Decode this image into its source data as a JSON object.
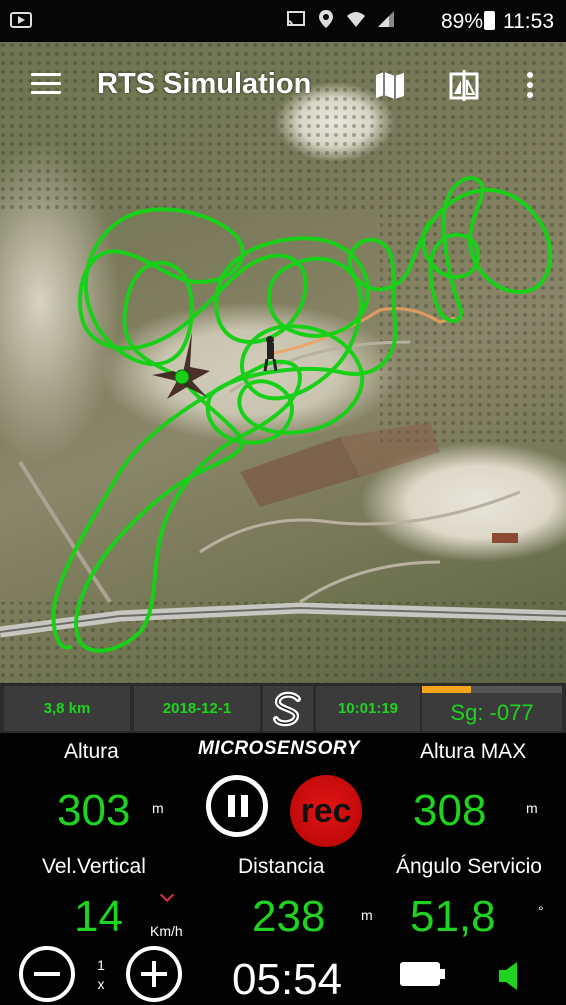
{
  "statusbar": {
    "battery_pct": "89%",
    "time": "11:53"
  },
  "appbar": {
    "title": "RTS Simulation"
  },
  "infobar": {
    "distance_total": "3,8 km",
    "date": "2018-12-1",
    "logo_letter": "S",
    "clock": "10:01:19",
    "signal_text": "Sg: -077",
    "signal_level": 0.35
  },
  "telemetry": {
    "brand": "MICROSENSORY",
    "altura_label": "Altura",
    "altura_value": "303",
    "altura_unit": "m",
    "altura_max_label": "Altura MAX",
    "altura_max_value": "308",
    "altura_max_unit": "m",
    "rec_label": "rec",
    "vel_label": "Vel.Vertical",
    "vel_value": "14",
    "vel_unit": "Km/h",
    "dist_label": "Distancia",
    "dist_value": "238",
    "dist_unit": "m",
    "angle_label": "Ángulo Servicio",
    "angle_value": "51,8",
    "angle_unit": "°",
    "zoom_value": "1",
    "zoom_unit": "x",
    "timer": "05:54"
  },
  "colors": {
    "track": "#19d019",
    "accent_green": "#1ed41e",
    "rec_red": "#d11010",
    "signal_orange": "#f4a51c"
  }
}
